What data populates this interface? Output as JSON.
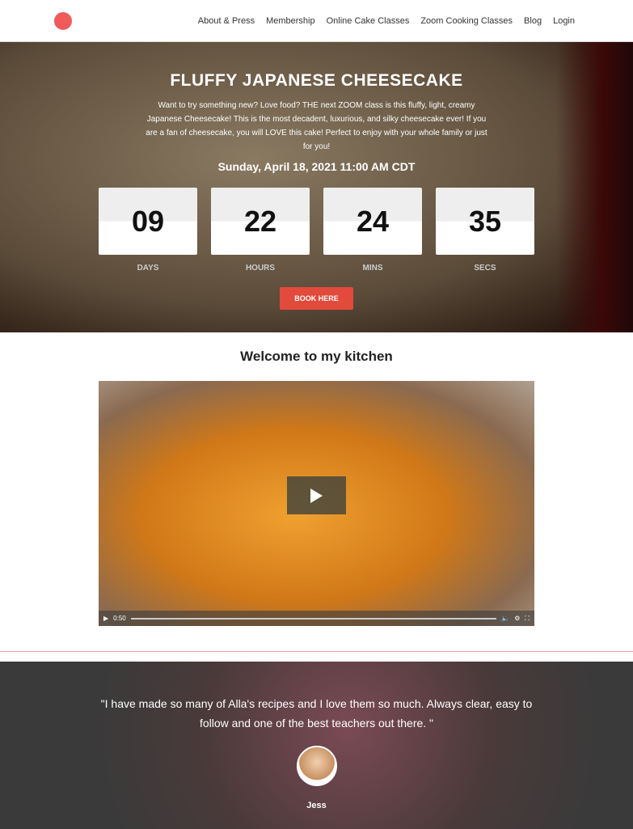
{
  "nav": {
    "items": [
      "About & Press",
      "Membership",
      "Online Cake Classes",
      "Zoom Cooking Classes",
      "Blog",
      "Login"
    ]
  },
  "hero": {
    "title": "FLUFFY JAPANESE CHEESECAKE",
    "description": "Want to try something new? Love food? THE next ZOOM class is this fluffy, light, creamy Japanese Cheesecake! This is the most decadent, luxurious, and silky cheesecake ever! If you are a fan of cheesecake, you will LOVE this cake! Perfect to enjoy with your whole family or just for you!",
    "date": "Sunday, April 18, 2021 11:00 AM CDT",
    "countdown": [
      {
        "value": "09",
        "label": "DAYS"
      },
      {
        "value": "22",
        "label": "HOURS"
      },
      {
        "value": "24",
        "label": "MINS"
      },
      {
        "value": "35",
        "label": "SECS"
      }
    ],
    "button": "BOOK HERE",
    "accent": "#e24a3b"
  },
  "welcome": {
    "title": "Welcome to my kitchen",
    "video": {
      "time": "0:50"
    }
  },
  "testimonial": {
    "quote": "\"I have made so many of Alla's recipes and I love them so much. Always clear, easy to follow and one of the best teachers out there. \"",
    "name": "Jess"
  }
}
